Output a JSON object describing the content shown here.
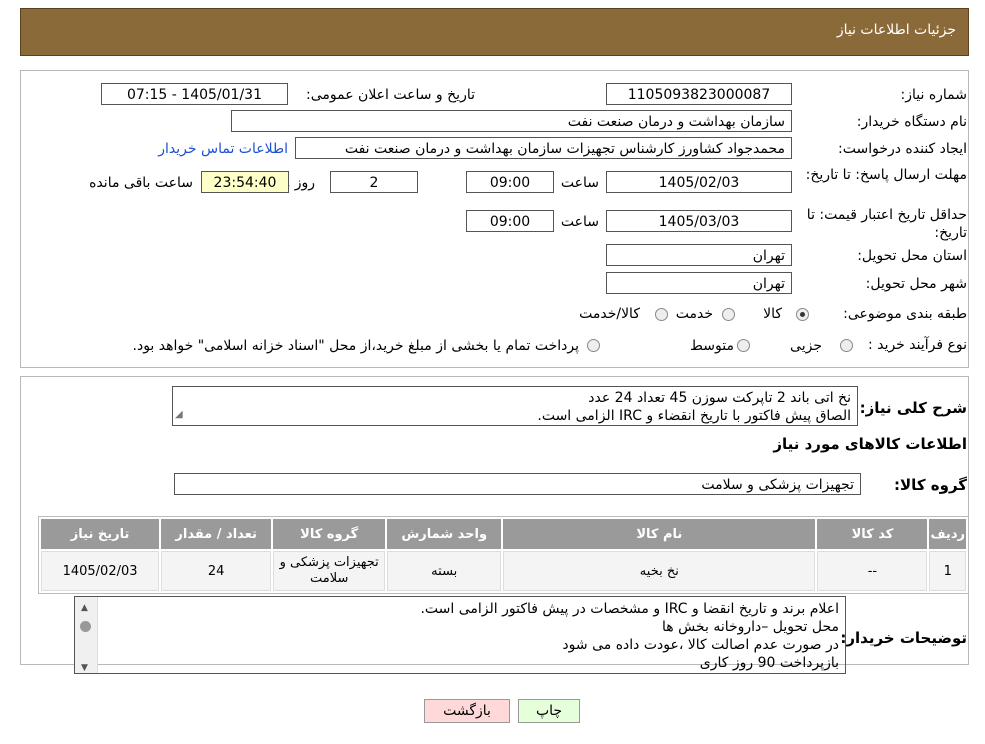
{
  "header": {
    "title": "جزئیات اطلاعات نیاز"
  },
  "fields": {
    "need_number_label": "شماره نیاز:",
    "need_number": "1105093823000087",
    "announce_label": "تاریخ و ساعت اعلان عمومی:",
    "announce_value": "1405/01/31 - 07:15",
    "buyer_org_label": "نام دستگاه خریدار:",
    "buyer_org": "سازمان بهداشت و درمان صنعت نفت",
    "creator_label": "ایجاد کننده درخواست:",
    "creator": "محمدجواد کشاورز کارشناس تجهیزات سازمان بهداشت و درمان صنعت نفت",
    "contact_link": "اطلاعات تماس خریدار",
    "deadline_label": "مهلت ارسال پاسخ: تا تاریخ:",
    "deadline_date": "1405/02/03",
    "time_label": "ساعت",
    "deadline_time": "09:00",
    "days_value": "2",
    "days_label": "روز و",
    "remaining_time": "23:54:40",
    "remaining_label": "ساعت باقی مانده",
    "validity_label": "حداقل تاریخ اعتبار قیمت: تا تاریخ:",
    "validity_date": "1405/03/03",
    "validity_time": "09:00",
    "province_label": "استان محل تحویل:",
    "province": "تهران",
    "city_label": "شهر محل تحویل:",
    "city": "تهران",
    "category_label": "طبقه بندی موضوعی:",
    "category_options": [
      "کالا",
      "خدمت",
      "کالا/خدمت"
    ],
    "process_label": "نوع فرآیند خرید :",
    "process_options": [
      "جزیی",
      "متوسط"
    ],
    "process_note": "پرداخت تمام یا بخشی از مبلغ خرید،از محل \"اسناد خزانه اسلامی\" خواهد بود."
  },
  "summary": {
    "label": "شرح کلی نیاز:",
    "line1": "نخ اتی باند 2 تاپرکت سوزن 45 تعداد 24 عدد",
    "line2": "الصاق پیش فاکتور با تاریخ انقضاء و IRC الزامی است."
  },
  "goods": {
    "section_title": "اطلاعات کالاهای مورد نیاز",
    "group_label": "گروه کالا:",
    "group_value": "تجهیزات پزشکی و سلامت",
    "columns": [
      "ردیف",
      "کد کالا",
      "نام کالا",
      "واحد شمارش",
      "گروه کالا",
      "تعداد / مقدار",
      "تاریخ نیاز"
    ],
    "rows": [
      [
        "1",
        "--",
        "نخ بخیه",
        "بسته",
        "تجهیزات پزشکی و سلامت",
        "24",
        "1405/02/03"
      ]
    ]
  },
  "buyer_notes": {
    "label": "توضیحات خریدار:",
    "lines": [
      "اعلام برند و تاریخ انقضا  و IRC  و مشخصات در پیش فاکتور الزامی است.",
      "محل تحویل –داروخانه بخش ها",
      "در صورت عدم اصالت کالا ،عودت داده می شود",
      "بازپرداخت 90 روز کاری"
    ]
  },
  "buttons": {
    "print": "چاپ",
    "back": "بازگشت"
  },
  "colors": {
    "header_bg": "#8b6a3a",
    "back_button_bg": "#ffd9d9",
    "print_button_bg": "#e4ffd9",
    "remaining_bg": "#ffffc8"
  }
}
